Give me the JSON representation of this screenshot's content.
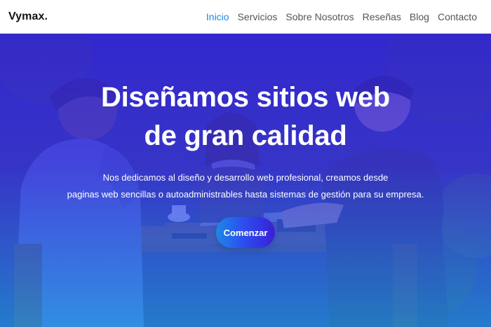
{
  "brand": {
    "name": "Vymax."
  },
  "nav": {
    "items": [
      {
        "label": "Inicio",
        "active": true
      },
      {
        "label": "Servicios",
        "active": false
      },
      {
        "label": "Sobre Nosotros",
        "active": false
      },
      {
        "label": "Reseñas",
        "active": false
      },
      {
        "label": "Blog",
        "active": false
      },
      {
        "label": "Contacto",
        "active": false
      }
    ]
  },
  "hero": {
    "title_line1": "Diseñamos sitios web",
    "title_line2": "de gran calidad",
    "desc_line1": "Nos dedicamos al diseño y desarrollo web profesional, creamos desde",
    "desc_line2": "paginas web sencillas o autoadministrables hasta sistemas de gestión para su empresa.",
    "cta_label": "Comenzar"
  },
  "colors": {
    "accent": "#1e88e5",
    "overlay_top": "#3424e4",
    "overlay_bottom": "#2196f3",
    "button_start": "#1e88e5",
    "button_end": "#3a1fd6"
  }
}
